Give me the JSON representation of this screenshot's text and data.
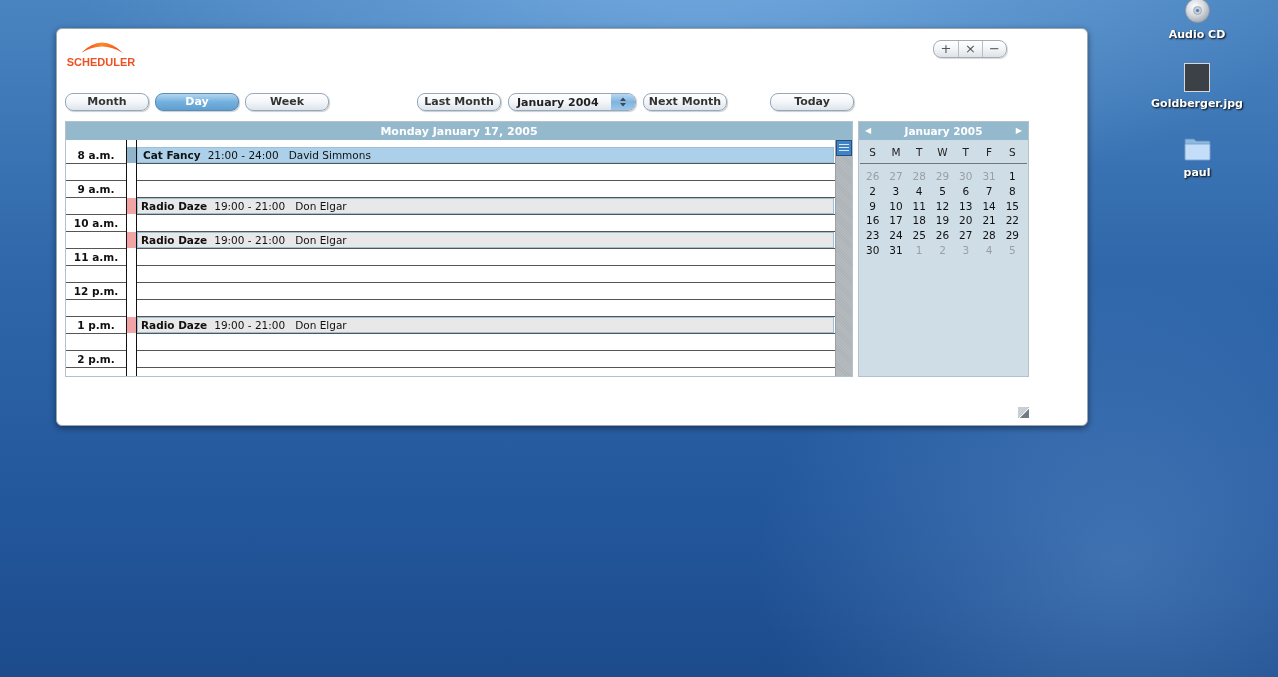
{
  "desktop_icons": [
    {
      "kind": "disc",
      "label": "Audio CD"
    },
    {
      "kind": "image",
      "label": "Goldberger.jpg"
    },
    {
      "kind": "folder",
      "label": "paul"
    }
  ],
  "app": {
    "logo": "SCHEDULER",
    "window_controls": [
      "+",
      "×",
      "−"
    ]
  },
  "view_tabs": [
    {
      "label": "Month",
      "selected": false
    },
    {
      "label": "Day",
      "selected": true
    },
    {
      "label": "Week",
      "selected": false
    }
  ],
  "navigation": {
    "previous_button": "Last Month",
    "month_select": {
      "value": "January 2004"
    },
    "next_button": "Next Month",
    "today_button": "Today"
  },
  "day_view": {
    "title": "Monday January 17, 2005",
    "rows": [
      {
        "kind": "hour",
        "time": "8 a.m.",
        "event": {
          "title": "Cat Fancy",
          "time": "21:00 - 24:00",
          "host": "David Simmons",
          "color": "#8fb4cb",
          "selected": true
        }
      },
      {
        "kind": "half"
      },
      {
        "kind": "hour",
        "time": "9 a.m."
      },
      {
        "kind": "half",
        "event": {
          "title": "Radio Daze",
          "time": "19:00 - 21:00",
          "host": "Don Elgar",
          "color": "#f2a3a3",
          "selected": false
        }
      },
      {
        "kind": "hour",
        "time": "10 a.m."
      },
      {
        "kind": "half",
        "event": {
          "title": "Radio Daze",
          "time": "19:00 - 21:00",
          "host": "Don Elgar",
          "color": "#f2a3a3",
          "selected": false
        }
      },
      {
        "kind": "hour",
        "time": "11 a.m."
      },
      {
        "kind": "half"
      },
      {
        "kind": "hour",
        "time": "12 p.m."
      },
      {
        "kind": "half"
      },
      {
        "kind": "hour",
        "time": "1 p.m.",
        "event": {
          "title": "Radio Daze",
          "time": "19:00 - 21:00",
          "host": "Don Elgar",
          "color": "#f2a3a3",
          "selected": false
        }
      },
      {
        "kind": "half"
      },
      {
        "kind": "hour",
        "time": "2 p.m."
      }
    ]
  },
  "mini_calendar": {
    "previous": "◀",
    "title": "January 2005",
    "next": "▶",
    "weekdays": [
      "S",
      "M",
      "T",
      "W",
      "T",
      "F",
      "S"
    ],
    "days": [
      {
        "label": "26",
        "other_month": true
      },
      {
        "label": "27",
        "other_month": true
      },
      {
        "label": "28",
        "other_month": true
      },
      {
        "label": "29",
        "other_month": true
      },
      {
        "label": "30",
        "other_month": true
      },
      {
        "label": "31",
        "other_month": true
      },
      {
        "label": "1",
        "other_month": false
      },
      {
        "label": "2",
        "other_month": false
      },
      {
        "label": "3",
        "other_month": false
      },
      {
        "label": "4",
        "other_month": false
      },
      {
        "label": "5",
        "other_month": false
      },
      {
        "label": "6",
        "other_month": false
      },
      {
        "label": "7",
        "other_month": false
      },
      {
        "label": "8",
        "other_month": false
      },
      {
        "label": "9",
        "other_month": false
      },
      {
        "label": "10",
        "other_month": false
      },
      {
        "label": "11",
        "other_month": false
      },
      {
        "label": "12",
        "other_month": false
      },
      {
        "label": "13",
        "other_month": false
      },
      {
        "label": "14",
        "other_month": false
      },
      {
        "label": "15",
        "other_month": false
      },
      {
        "label": "16",
        "other_month": false
      },
      {
        "label": "17",
        "other_month": false
      },
      {
        "label": "18",
        "other_month": false
      },
      {
        "label": "19",
        "other_month": false
      },
      {
        "label": "20",
        "other_month": false
      },
      {
        "label": "21",
        "other_month": false
      },
      {
        "label": "22",
        "other_month": false
      },
      {
        "label": "23",
        "other_month": false
      },
      {
        "label": "24",
        "other_month": false
      },
      {
        "label": "25",
        "other_month": false
      },
      {
        "label": "26",
        "other_month": false
      },
      {
        "label": "27",
        "other_month": false
      },
      {
        "label": "28",
        "other_month": false
      },
      {
        "label": "29",
        "other_month": false
      },
      {
        "label": "30",
        "other_month": false
      },
      {
        "label": "31",
        "other_month": false
      },
      {
        "label": "1",
        "other_month": true
      },
      {
        "label": "2",
        "other_month": true
      },
      {
        "label": "3",
        "other_month": true
      },
      {
        "label": "4",
        "other_month": true
      },
      {
        "label": "5",
        "other_month": true
      }
    ]
  }
}
